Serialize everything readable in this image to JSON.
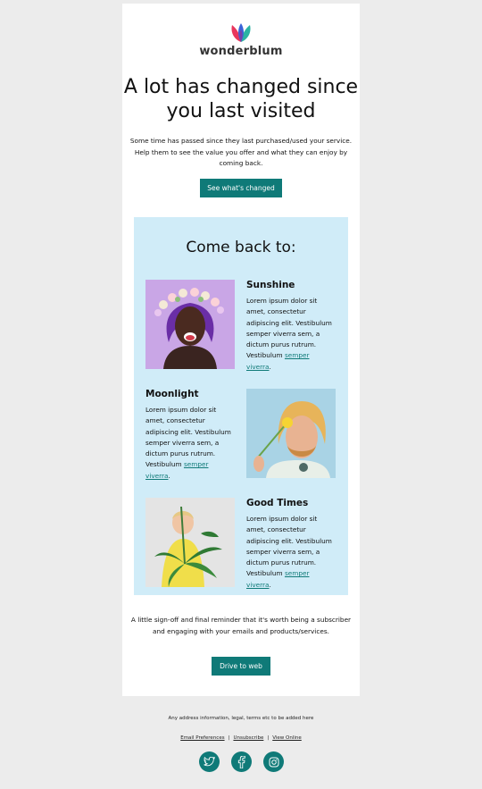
{
  "brand": {
    "name": "wonderblum"
  },
  "hero": {
    "headline": "A lot has changed since you last visited",
    "intro": "Some time has passed since they last purchased/used your service. Help them to see the value you offer and what they can enjoy by coming back.",
    "cta_label": "See what's changed"
  },
  "come_back": {
    "title": "Come back to:",
    "items": [
      {
        "title": "Sunshine",
        "body": "Lorem ipsum dolor sit amet, consectetur adipiscing elit. Vestibulum semper viverra sem, a dictum purus rutrum. Vestibulum ",
        "link": "semper viverra",
        "end": "."
      },
      {
        "title": "Moonlight",
        "body": "Lorem ipsum dolor sit amet, consectetur adipiscing elit. Vestibulum semper viverra sem, a dictum purus rutrum. Vestibulum ",
        "link": "semper viverra",
        "end": "."
      },
      {
        "title": "Good Times",
        "body": "Lorem ipsum dolor sit amet, consectetur adipiscing elit. Vestibulum semper viverra sem, a dictum purus rutrum. Vestibulum ",
        "link": "semper viverra",
        "end": "."
      }
    ]
  },
  "signoff": {
    "text": "A little sign-off and final reminder that it's worth being a subscriber and engaging with your emails and products/services.",
    "cta_label": "Drive to web"
  },
  "footer": {
    "address": "Any address information, legal, terms etc to be added here",
    "links": {
      "preferences": "Email Preferences",
      "unsubscribe": "Unsubscribe",
      "view_online": "View Online",
      "separator": "|"
    },
    "social_icons": [
      "twitter-icon",
      "facebook-icon",
      "instagram-icon"
    ]
  },
  "colors": {
    "accent": "#0f7a78",
    "panel": "#d0ecf8",
    "page_bg": "#ececec",
    "card_bg": "#ffffff"
  }
}
